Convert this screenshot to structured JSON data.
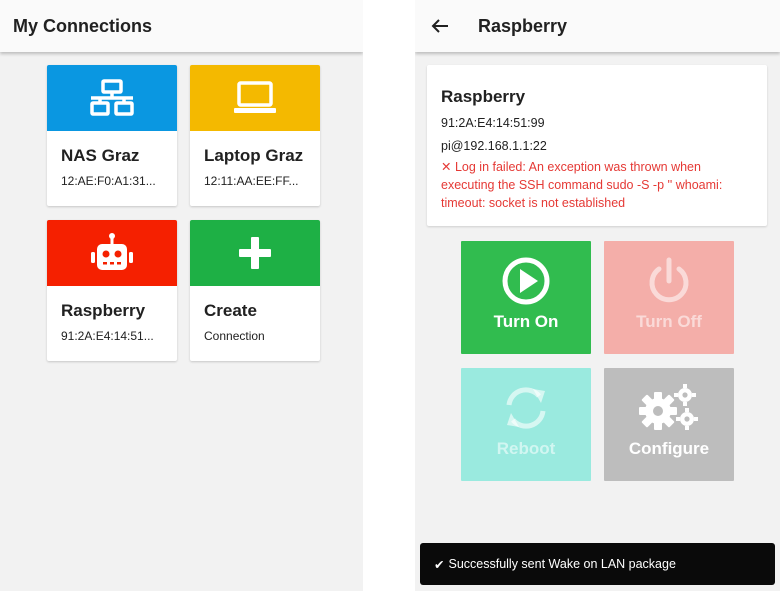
{
  "left": {
    "title": "My Connections",
    "tiles": [
      {
        "name": "NAS Graz",
        "sub": "12:AE:F0:A1:31...",
        "color": "#0a97e1",
        "icon": "network-icon"
      },
      {
        "name": "Laptop Graz",
        "sub": "12:11:AA:EE:FF...",
        "color": "#f4b900",
        "icon": "laptop-icon"
      },
      {
        "name": "Raspberry",
        "sub": "91:2A:E4:14:51...",
        "color": "#f52000",
        "icon": "robot-icon"
      },
      {
        "name": "Create",
        "sub": "Connection",
        "color": "#1eb045",
        "icon": "plus-icon"
      }
    ]
  },
  "right": {
    "title": "Raspberry",
    "info": {
      "name": "Raspberry",
      "mac": "91:2A:E4:14:51:99",
      "ssh": "pi@192.168.1.1:22",
      "error": "Log in failed: An exception was thrown when executing the SSH command sudo -S -p '' whoami: timeout: socket is not established"
    },
    "actions": [
      {
        "label": "Turn On",
        "color": "#31bc4f",
        "icon": "power-on-icon",
        "enabled": true
      },
      {
        "label": "Turn Off",
        "color": "#f4aea9",
        "icon": "power-off-icon",
        "enabled": false
      },
      {
        "label": "Reboot",
        "color": "#9aeadf",
        "icon": "refresh-icon",
        "enabled": false
      },
      {
        "label": "Configure",
        "color": "#bdbdbd",
        "icon": "gears-icon",
        "enabled": true
      }
    ],
    "snackbar": "Successfully sent Wake on LAN package"
  }
}
